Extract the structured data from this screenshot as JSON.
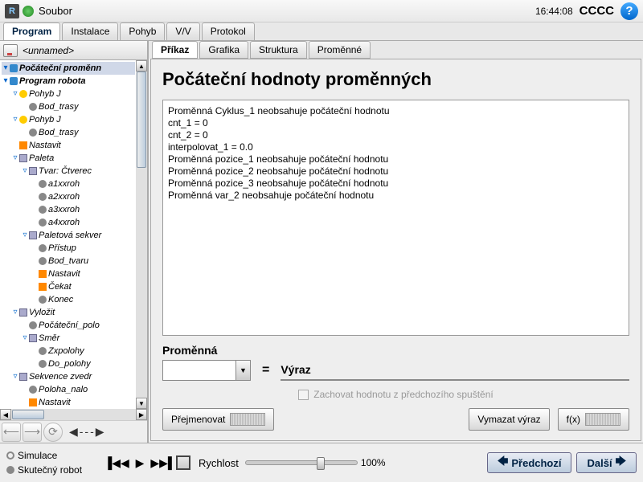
{
  "titlebar": {
    "menu": "Soubor",
    "time": "16:44:08",
    "status": "CCCC"
  },
  "maintabs": [
    "Program",
    "Instalace",
    "Pohyb",
    "V/V",
    "Protokol"
  ],
  "file": {
    "name": "<unnamed>"
  },
  "tree": [
    {
      "d": 0,
      "e": "▾",
      "i": "ic-blue",
      "t": "Počáteční proměnn",
      "b": true,
      "sel": true
    },
    {
      "d": 0,
      "e": "▾",
      "i": "ic-blue",
      "t": "Program robota",
      "b": true
    },
    {
      "d": 1,
      "e": "▿",
      "i": "ic-yellow",
      "t": "Pohyb J"
    },
    {
      "d": 2,
      "e": "",
      "i": "ic-gray",
      "t": "Bod_trasy"
    },
    {
      "d": 1,
      "e": "▿",
      "i": "ic-yellow",
      "t": "Pohyb J"
    },
    {
      "d": 2,
      "e": "",
      "i": "ic-gray",
      "t": "Bod_trasy"
    },
    {
      "d": 1,
      "e": "",
      "i": "ic-orange",
      "t": "Nastavit"
    },
    {
      "d": 1,
      "e": "▿",
      "i": "ic-group",
      "t": "Paleta"
    },
    {
      "d": 2,
      "e": "▿",
      "i": "ic-group",
      "t": "Tvar: Čtverec"
    },
    {
      "d": 3,
      "e": "",
      "i": "ic-gray",
      "t": "a1xxroh"
    },
    {
      "d": 3,
      "e": "",
      "i": "ic-gray",
      "t": "a2xxroh"
    },
    {
      "d": 3,
      "e": "",
      "i": "ic-gray",
      "t": "a3xxroh"
    },
    {
      "d": 3,
      "e": "",
      "i": "ic-gray",
      "t": "a4xxroh"
    },
    {
      "d": 2,
      "e": "▿",
      "i": "ic-group",
      "t": "Paletová sekver"
    },
    {
      "d": 3,
      "e": "",
      "i": "ic-gray",
      "t": "Přístup"
    },
    {
      "d": 3,
      "e": "",
      "i": "ic-gray",
      "t": "Bod_tvaru"
    },
    {
      "d": 3,
      "e": "",
      "i": "ic-orange",
      "t": "Nastavit"
    },
    {
      "d": 3,
      "e": "",
      "i": "ic-orange",
      "t": "Čekat"
    },
    {
      "d": 3,
      "e": "",
      "i": "ic-gray",
      "t": "Konec"
    },
    {
      "d": 1,
      "e": "▿",
      "i": "ic-group",
      "t": "Vyložit"
    },
    {
      "d": 2,
      "e": "",
      "i": "ic-gray",
      "t": "Počáteční_polo"
    },
    {
      "d": 2,
      "e": "▿",
      "i": "ic-group",
      "t": "Směr"
    },
    {
      "d": 3,
      "e": "",
      "i": "ic-gray",
      "t": "Zxpolohy"
    },
    {
      "d": 3,
      "e": "",
      "i": "ic-gray",
      "t": "Do_polohy"
    },
    {
      "d": 1,
      "e": "▿",
      "i": "ic-group",
      "t": "Sekvence zvedr"
    },
    {
      "d": 2,
      "e": "",
      "i": "ic-gray",
      "t": "Poloha_nalo"
    },
    {
      "d": 2,
      "e": "",
      "i": "ic-orange",
      "t": "Nastavit"
    }
  ],
  "subtabs": [
    "Příkaz",
    "Grafika",
    "Struktura",
    "Proměnné"
  ],
  "content": {
    "heading": "Počáteční hodnoty proměnných",
    "lines": [
      "Proměnná Cyklus_1 neobsahuje počáteční hodnotu",
      "cnt_1 = 0",
      "cnt_2 = 0",
      "interpolovat_1 = 0.0",
      "Proměnná pozice_1 neobsahuje počáteční hodnotu",
      "Proměnná pozice_2 neobsahuje počáteční hodnotu",
      "Proměnná pozice_3 neobsahuje počáteční hodnotu",
      "Proměnná var_2 neobsahuje počáteční hodnotu"
    ],
    "var_label": "Proměnná",
    "expr_label": "Výraz",
    "eq": "=",
    "keep_label": "Zachovat hodnotu z předchozího spuštění",
    "rename": "Přejmenovat",
    "clear": "Vymazat výraz",
    "fx": "f(x)"
  },
  "footer": {
    "sim": "Simulace",
    "real": "Skutečný robot",
    "speed_label": "Rychlost",
    "speed_val": "100%",
    "prev": "Předchozí",
    "next": "Další"
  }
}
